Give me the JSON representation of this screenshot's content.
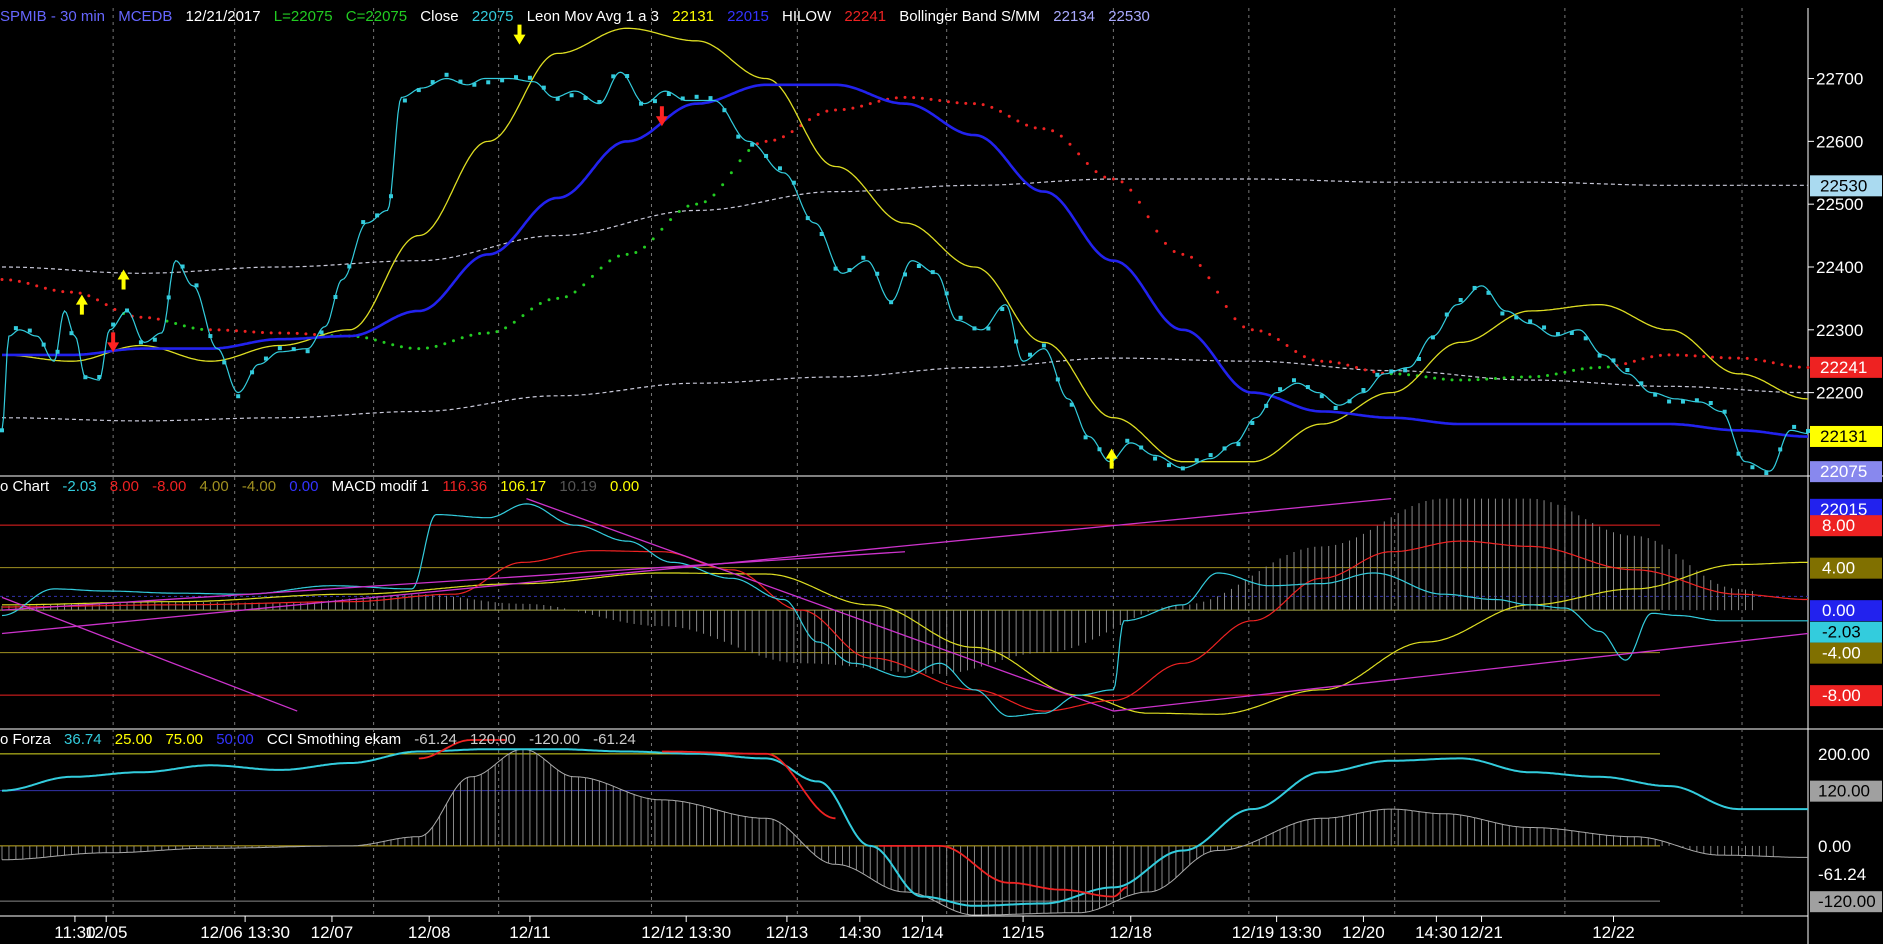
{
  "header": {
    "symbol": "SPMIB - 30 min",
    "source": "MCEDB",
    "date": "12/21/2017",
    "last": "L=22075",
    "close_eq": "C=22075",
    "close_label": "Close",
    "close_value": "22075",
    "mavg_label": "Leon Mov Avg 1 a 3",
    "mavg_1": "22131",
    "mavg_2": "22015",
    "hilow_label": "HILOW",
    "hilow_value": "22241",
    "bb_label": "Bollinger Band S/MM",
    "bb_lower": "22134",
    "bb_upper": "22530"
  },
  "macd_header": {
    "label": "o Chart",
    "v1": "-2.03",
    "v2": "8.00",
    "v3": "-8.00",
    "v4": "4.00",
    "v5": "-4.00",
    "v6": "0.00",
    "macd_label": "MACD modif 1",
    "m1": "116.36",
    "m2": "106.17",
    "m3": "10.19",
    "m4": "0.00"
  },
  "cci_header": {
    "label": "o Forza",
    "v1": "36.74",
    "v2": "25.00",
    "v3": "75.00",
    "v4": "50.00",
    "cci_label": "CCI Smothing ekam",
    "c1": "-61.24",
    "c2": "120.00",
    "c3": "-120.00",
    "c4": "-61.24"
  },
  "colors": {
    "close": "#33ccdd",
    "mavg_fast": "#dddd22",
    "mavg_slow": "#2222ee",
    "hilow_red": "#ee2222",
    "hilow_green": "#22cc22",
    "bollinger": "#c8c8d8",
    "arrow_up": "#ffff00",
    "arrow_down": "#ff2222",
    "grid": "#777777",
    "trendline": "#cc33cc",
    "histogram": "#888888"
  },
  "chart_data": [
    {
      "type": "line",
      "name": "price",
      "ylim": [
        22080,
        22790
      ],
      "y_ticks": [
        22200,
        22300,
        22400,
        22500,
        22600,
        22700
      ],
      "x_labels": [
        "11:30",
        "12/05",
        "12/06 13:30",
        "12/07",
        "12/08",
        "12/11",
        "12/12 13:30",
        "12/13",
        "14:30",
        "12/14",
        "12/15",
        "12/18",
        "12/19 13:30",
        "12/20",
        "14:30",
        "12/21",
        "12/22"
      ],
      "series": [
        {
          "name": "Close",
          "color_key": "close",
          "key_points": [
            [
              0,
              22140
            ],
            [
              4,
              22290
            ],
            [
              10,
              22300
            ],
            [
              20,
              22290
            ],
            [
              30,
              22250
            ],
            [
              36,
              22330
            ],
            [
              42,
              22290
            ],
            [
              48,
              22225
            ],
            [
              56,
              22220
            ],
            [
              62,
              22300
            ],
            [
              72,
              22330
            ],
            [
              82,
              22280
            ],
            [
              92,
              22295
            ],
            [
              100,
              22410
            ],
            [
              110,
              22370
            ],
            [
              124,
              22270
            ],
            [
              136,
              22200
            ],
            [
              148,
              22245
            ],
            [
              160,
              22265
            ],
            [
              176,
              22270
            ],
            [
              186,
              22305
            ],
            [
              196,
              22380
            ],
            [
              210,
              22470
            ],
            [
              222,
              22490
            ],
            [
              230,
              22670
            ],
            [
              242,
              22685
            ],
            [
              256,
              22700
            ],
            [
              268,
              22690
            ],
            [
              278,
              22700
            ],
            [
              292,
              22700
            ],
            [
              306,
              22695
            ],
            [
              318,
              22670
            ],
            [
              330,
              22680
            ],
            [
              344,
              22660
            ],
            [
              356,
              22710
            ],
            [
              370,
              22660
            ],
            [
              382,
              22680
            ],
            [
              394,
              22665
            ],
            [
              410,
              22665
            ],
            [
              430,
              22600
            ],
            [
              450,
              22550
            ],
            [
              468,
              22470
            ],
            [
              484,
              22390
            ],
            [
              498,
              22410
            ],
            [
              512,
              22345
            ],
            [
              524,
              22410
            ],
            [
              538,
              22390
            ],
            [
              550,
              22315
            ],
            [
              564,
              22300
            ],
            [
              578,
              22340
            ],
            [
              588,
              22250
            ],
            [
              600,
              22270
            ],
            [
              614,
              22190
            ],
            [
              626,
              22130
            ],
            [
              638,
              22090
            ],
            [
              650,
              22120
            ],
            [
              664,
              22100
            ],
            [
              680,
              22080
            ],
            [
              696,
              22095
            ],
            [
              710,
              22120
            ],
            [
              722,
              22160
            ],
            [
              734,
              22200
            ],
            [
              746,
              22215
            ],
            [
              758,
              22200
            ],
            [
              770,
              22180
            ],
            [
              784,
              22200
            ],
            [
              796,
              22230
            ],
            [
              810,
              22240
            ],
            [
              824,
              22290
            ],
            [
              838,
              22340
            ],
            [
              852,
              22370
            ],
            [
              866,
              22330
            ],
            [
              880,
              22310
            ],
            [
              894,
              22290
            ],
            [
              908,
              22300
            ],
            [
              922,
              22260
            ],
            [
              936,
              22230
            ],
            [
              950,
              22200
            ],
            [
              964,
              22190
            ],
            [
              978,
              22185
            ],
            [
              990,
              22170
            ],
            [
              1004,
              22090
            ],
            [
              1018,
              22075
            ],
            [
              1030,
              22140
            ],
            [
              1040,
              22135
            ]
          ]
        },
        {
          "name": "Leon Mov Avg fast",
          "color_key": "mavg_fast",
          "key_points": [
            [
              0,
              22260
            ],
            [
              40,
              22250
            ],
            [
              80,
              22275
            ],
            [
              120,
              22250
            ],
            [
              160,
              22275
            ],
            [
              200,
              22300
            ],
            [
              240,
              22450
            ],
            [
              280,
              22600
            ],
            [
              320,
              22740
            ],
            [
              360,
              22780
            ],
            [
              400,
              22760
            ],
            [
              440,
              22700
            ],
            [
              480,
              22560
            ],
            [
              520,
              22470
            ],
            [
              560,
              22400
            ],
            [
              600,
              22280
            ],
            [
              640,
              22160
            ],
            [
              680,
              22090
            ],
            [
              720,
              22090
            ],
            [
              760,
              22150
            ],
            [
              800,
              22200
            ],
            [
              840,
              22280
            ],
            [
              880,
              22330
            ],
            [
              920,
              22340
            ],
            [
              960,
              22300
            ],
            [
              1000,
              22230
            ],
            [
              1040,
              22190
            ]
          ]
        },
        {
          "name": "Leon Mov Avg slow",
          "color_key": "mavg_slow",
          "key_points": [
            [
              0,
              22260
            ],
            [
              40,
              22260
            ],
            [
              80,
              22270
            ],
            [
              120,
              22270
            ],
            [
              160,
              22285
            ],
            [
              200,
              22290
            ],
            [
              240,
              22330
            ],
            [
              280,
              22420
            ],
            [
              320,
              22510
            ],
            [
              360,
              22600
            ],
            [
              400,
              22660
            ],
            [
              440,
              22690
            ],
            [
              480,
              22690
            ],
            [
              520,
              22660
            ],
            [
              560,
              22610
            ],
            [
              600,
              22520
            ],
            [
              640,
              22410
            ],
            [
              680,
              22300
            ],
            [
              720,
              22200
            ],
            [
              760,
              22170
            ],
            [
              800,
              22160
            ],
            [
              840,
              22150
            ],
            [
              880,
              22150
            ],
            [
              920,
              22150
            ],
            [
              960,
              22150
            ],
            [
              1000,
              22140
            ],
            [
              1040,
              22130
            ]
          ]
        },
        {
          "name": "HILOW",
          "color_key": "hilow_red",
          "key_points": [
            [
              0,
              22380
            ],
            [
              40,
              22360
            ],
            [
              80,
              22320
            ],
            [
              120,
              22300
            ],
            [
              160,
              22295
            ],
            [
              200,
              22290
            ],
            [
              240,
              22270
            ],
            [
              280,
              22295
            ],
            [
              320,
              22350
            ],
            [
              360,
              22420
            ],
            [
              400,
              22500
            ],
            [
              440,
              22600
            ],
            [
              480,
              22650
            ],
            [
              520,
              22670
            ],
            [
              560,
              22660
            ],
            [
              600,
              22620
            ],
            [
              640,
              22540
            ],
            [
              680,
              22420
            ],
            [
              720,
              22300
            ],
            [
              760,
              22250
            ],
            [
              800,
              22230
            ],
            [
              840,
              22220
            ],
            [
              880,
              22225
            ],
            [
              920,
              22240
            ],
            [
              960,
              22260
            ],
            [
              1000,
              22255
            ],
            [
              1040,
              22240
            ]
          ]
        },
        {
          "name": "Bollinger upper",
          "color_key": "bollinger",
          "key_points": [
            [
              0,
              22400
            ],
            [
              80,
              22390
            ],
            [
              160,
              22400
            ],
            [
              240,
              22410
            ],
            [
              320,
              22450
            ],
            [
              400,
              22490
            ],
            [
              480,
              22520
            ],
            [
              560,
              22530
            ],
            [
              640,
              22540
            ],
            [
              720,
              22540
            ],
            [
              800,
              22535
            ],
            [
              880,
              22535
            ],
            [
              960,
              22530
            ],
            [
              1040,
              22530
            ]
          ]
        },
        {
          "name": "Bollinger lower",
          "color_key": "bollinger",
          "key_points": [
            [
              0,
              22160
            ],
            [
              80,
              22155
            ],
            [
              160,
              22160
            ],
            [
              240,
              22170
            ],
            [
              320,
              22195
            ],
            [
              400,
              22215
            ],
            [
              480,
              22225
            ],
            [
              560,
              22240
            ],
            [
              640,
              22255
            ],
            [
              720,
              22250
            ],
            [
              800,
              22235
            ],
            [
              880,
              22220
            ],
            [
              960,
              22210
            ],
            [
              1040,
              22200
            ]
          ]
        }
      ],
      "arrows": [
        {
          "x": 46,
          "y": 22340,
          "dir": "up",
          "color_key": "arrow_up"
        },
        {
          "x": 64,
          "y": 22280,
          "dir": "down",
          "color_key": "arrow_down"
        },
        {
          "x": 70,
          "y": 22380,
          "dir": "up",
          "color_key": "arrow_up"
        },
        {
          "x": 298,
          "y": 22770,
          "dir": "down",
          "color_key": "arrow_up"
        },
        {
          "x": 380,
          "y": 22640,
          "dir": "down",
          "color_key": "arrow_down"
        },
        {
          "x": 639,
          "y": 22095,
          "dir": "up",
          "color_key": "arrow_up"
        }
      ],
      "right_labels": [
        {
          "text": "22530",
          "value": 22530,
          "bg": "#aadaf0",
          "fg": "#000000"
        },
        {
          "text": "22241",
          "value": 22241,
          "bg": "#ee2222",
          "fg": "#ffffff"
        },
        {
          "text": "22131",
          "value": 22131,
          "bg": "#ffff00",
          "fg": "#000000"
        },
        {
          "text": "22075",
          "value": 22075,
          "bg": "#8888ee",
          "fg": "#ffffff"
        },
        {
          "text": "22015",
          "value": 22015,
          "bg": "#2222ee",
          "fg": "#ffffff"
        }
      ]
    },
    {
      "type": "line",
      "name": "macd",
      "ylim": [
        -11,
        11.5
      ],
      "levels": [
        8,
        4,
        0,
        -4,
        -8
      ],
      "right_labels": [
        {
          "text": "8.00",
          "value": 8,
          "bg": "#ee2222",
          "fg": "#ffffff"
        },
        {
          "text": "4.00",
          "value": 4,
          "bg": "#807000",
          "fg": "#ffffff"
        },
        {
          "text": "0.00",
          "value": 0,
          "bg": "#2222ee",
          "fg": "#ffffff"
        },
        {
          "text": "-2.03",
          "value": -2.03,
          "bg": "#33ccdd",
          "fg": "#000000"
        },
        {
          "text": "-4.00",
          "value": -4,
          "bg": "#807000",
          "fg": "#ffffff"
        },
        {
          "text": "-8.00",
          "value": -8,
          "bg": "#ee2222",
          "fg": "#ffffff"
        }
      ]
    },
    {
      "type": "line",
      "name": "cci",
      "ylim": [
        -150,
        230
      ],
      "levels": [
        200,
        120,
        0,
        -120
      ],
      "right_labels": [
        {
          "text": "200.00",
          "value": 200,
          "bg": "#000000",
          "fg": "#ffffff"
        },
        {
          "text": "120.00",
          "value": 120,
          "bg": "#a0a0a0",
          "fg": "#000000"
        },
        {
          "text": "0.00",
          "value": 0,
          "bg": "#000000",
          "fg": "#ffffff"
        },
        {
          "text": "-61.24",
          "value": -61.24,
          "bg": "#000000",
          "fg": "#ffffff"
        },
        {
          "text": "-120.00",
          "value": -120,
          "bg": "#a0a0a0",
          "fg": "#000000"
        }
      ]
    }
  ]
}
